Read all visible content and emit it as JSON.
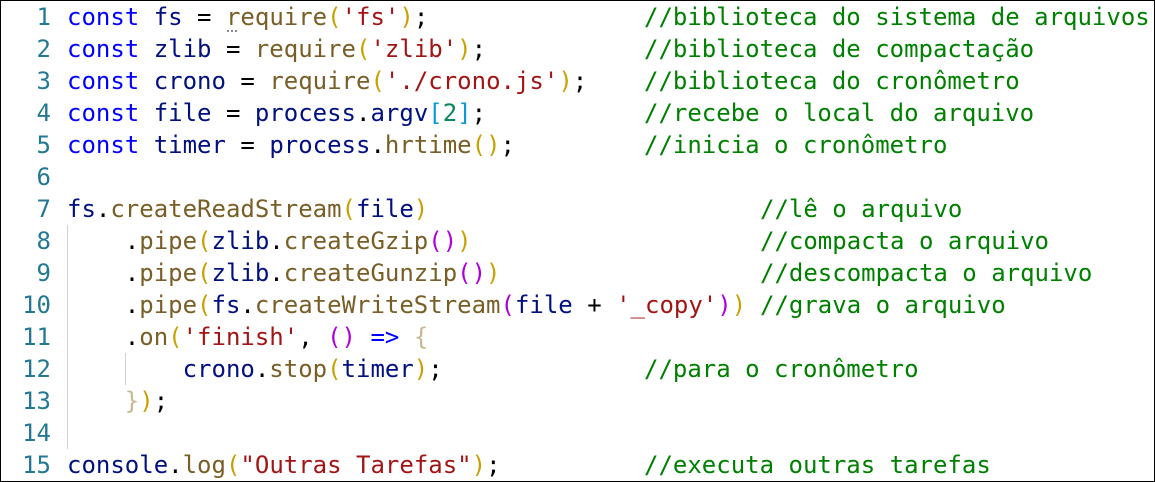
{
  "editor": {
    "colors": {
      "keyword": "#0000ff",
      "variable": "#001080",
      "function": "#795e26",
      "string": "#a31515",
      "number": "#098658",
      "comment": "#008000",
      "line_number": "#237893",
      "bracket_1": "#c8a000",
      "bracket_2": "#af00db",
      "bracket_3": "#0a9ad8"
    },
    "lines": [
      {
        "number": "1",
        "tokens": [
          {
            "t": "const",
            "c": "kw"
          },
          {
            "t": " ",
            "c": "op"
          },
          {
            "t": "fs",
            "c": "var"
          },
          {
            "t": " = ",
            "c": "op"
          },
          {
            "t": "require",
            "c": "fn"
          },
          {
            "t": "(",
            "c": "p1"
          },
          {
            "t": "'fs'",
            "c": "str"
          },
          {
            "t": ")",
            "c": "p1"
          },
          {
            "t": ";",
            "c": "op"
          }
        ],
        "comment": "//biblioteca do sistema de arquivos"
      },
      {
        "number": "2",
        "tokens": [
          {
            "t": "const",
            "c": "kw"
          },
          {
            "t": " ",
            "c": "op"
          },
          {
            "t": "zlib",
            "c": "var"
          },
          {
            "t": " = ",
            "c": "op"
          },
          {
            "t": "require",
            "c": "fn"
          },
          {
            "t": "(",
            "c": "p1"
          },
          {
            "t": "'zlib'",
            "c": "str"
          },
          {
            "t": ")",
            "c": "p1"
          },
          {
            "t": ";",
            "c": "op"
          }
        ],
        "comment": "//biblioteca de compactação"
      },
      {
        "number": "3",
        "tokens": [
          {
            "t": "const",
            "c": "kw"
          },
          {
            "t": " ",
            "c": "op"
          },
          {
            "t": "crono",
            "c": "var"
          },
          {
            "t": " = ",
            "c": "op"
          },
          {
            "t": "require",
            "c": "fn"
          },
          {
            "t": "(",
            "c": "p1"
          },
          {
            "t": "'./crono.js'",
            "c": "str"
          },
          {
            "t": ")",
            "c": "p1"
          },
          {
            "t": ";",
            "c": "op"
          }
        ],
        "comment": "//biblioteca do cronômetro"
      },
      {
        "number": "4",
        "tokens": [
          {
            "t": "const",
            "c": "kw"
          },
          {
            "t": " ",
            "c": "op"
          },
          {
            "t": "file",
            "c": "var"
          },
          {
            "t": " = ",
            "c": "op"
          },
          {
            "t": "process",
            "c": "var"
          },
          {
            "t": ".",
            "c": "op"
          },
          {
            "t": "argv",
            "c": "var"
          },
          {
            "t": "[",
            "c": "p3"
          },
          {
            "t": "2",
            "c": "num"
          },
          {
            "t": "]",
            "c": "p3"
          },
          {
            "t": ";",
            "c": "op"
          }
        ],
        "comment": "//recebe o local do arquivo"
      },
      {
        "number": "5",
        "tokens": [
          {
            "t": "const",
            "c": "kw"
          },
          {
            "t": " ",
            "c": "op"
          },
          {
            "t": "timer",
            "c": "var"
          },
          {
            "t": " = ",
            "c": "op"
          },
          {
            "t": "process",
            "c": "var"
          },
          {
            "t": ".",
            "c": "op"
          },
          {
            "t": "hrtime",
            "c": "fn"
          },
          {
            "t": "()",
            "c": "p1"
          },
          {
            "t": ";",
            "c": "op"
          }
        ],
        "comment": "//inicia o cronômetro"
      },
      {
        "number": "6",
        "tokens": [],
        "comment": ""
      },
      {
        "number": "7",
        "tokens": [
          {
            "t": "fs",
            "c": "var"
          },
          {
            "t": ".",
            "c": "op"
          },
          {
            "t": "createReadStream",
            "c": "fn"
          },
          {
            "t": "(",
            "c": "p1"
          },
          {
            "t": "file",
            "c": "var"
          },
          {
            "t": ")",
            "c": "p1"
          }
        ],
        "comment": "//lê o arquivo"
      },
      {
        "number": "8",
        "tokens": [
          {
            "t": "    .",
            "c": "op"
          },
          {
            "t": "pipe",
            "c": "fn"
          },
          {
            "t": "(",
            "c": "p1"
          },
          {
            "t": "zlib",
            "c": "var"
          },
          {
            "t": ".",
            "c": "op"
          },
          {
            "t": "createGzip",
            "c": "fn"
          },
          {
            "t": "()",
            "c": "p2"
          },
          {
            "t": ")",
            "c": "p1"
          }
        ],
        "comment": "//compacta o arquivo"
      },
      {
        "number": "9",
        "tokens": [
          {
            "t": "    .",
            "c": "op"
          },
          {
            "t": "pipe",
            "c": "fn"
          },
          {
            "t": "(",
            "c": "p1"
          },
          {
            "t": "zlib",
            "c": "var"
          },
          {
            "t": ".",
            "c": "op"
          },
          {
            "t": "createGunzip",
            "c": "fn"
          },
          {
            "t": "()",
            "c": "p2"
          },
          {
            "t": ")",
            "c": "p1"
          }
        ],
        "comment": "//descompacta o arquivo"
      },
      {
        "number": "10",
        "tokens": [
          {
            "t": "    .",
            "c": "op"
          },
          {
            "t": "pipe",
            "c": "fn"
          },
          {
            "t": "(",
            "c": "p1"
          },
          {
            "t": "fs",
            "c": "var"
          },
          {
            "t": ".",
            "c": "op"
          },
          {
            "t": "createWriteStream",
            "c": "fn"
          },
          {
            "t": "(",
            "c": "p2"
          },
          {
            "t": "file",
            "c": "var"
          },
          {
            "t": " + ",
            "c": "op"
          },
          {
            "t": "'_copy'",
            "c": "str"
          },
          {
            "t": ")",
            "c": "p2"
          },
          {
            "t": ")",
            "c": "p1"
          },
          {
            "t": " ",
            "c": "op"
          }
        ],
        "comment": "//grava o arquivo"
      },
      {
        "number": "11",
        "tokens": [
          {
            "t": "    .",
            "c": "op"
          },
          {
            "t": "on",
            "c": "fn"
          },
          {
            "t": "(",
            "c": "p1"
          },
          {
            "t": "'finish'",
            "c": "str"
          },
          {
            "t": ", ",
            "c": "op"
          },
          {
            "t": "()",
            "c": "p2"
          },
          {
            "t": " ",
            "c": "op"
          },
          {
            "t": "=>",
            "c": "kw"
          },
          {
            "t": " ",
            "c": "op"
          },
          {
            "t": "{",
            "c": "dim"
          }
        ],
        "comment": ""
      },
      {
        "number": "12",
        "tokens": [
          {
            "t": "        ",
            "c": "op"
          },
          {
            "t": "crono",
            "c": "var"
          },
          {
            "t": ".",
            "c": "op"
          },
          {
            "t": "stop",
            "c": "fn"
          },
          {
            "t": "(",
            "c": "p1"
          },
          {
            "t": "timer",
            "c": "var"
          },
          {
            "t": ")",
            "c": "p1"
          },
          {
            "t": ";",
            "c": "op"
          }
        ],
        "comment": "//para o cronômetro"
      },
      {
        "number": "13",
        "tokens": [
          {
            "t": "    ",
            "c": "op"
          },
          {
            "t": "}",
            "c": "dim"
          },
          {
            "t": ")",
            "c": "p1"
          },
          {
            "t": ";",
            "c": "op"
          }
        ],
        "comment": ""
      },
      {
        "number": "14",
        "tokens": [],
        "comment": ""
      },
      {
        "number": "15",
        "tokens": [
          {
            "t": "console",
            "c": "var"
          },
          {
            "t": ".",
            "c": "op"
          },
          {
            "t": "log",
            "c": "fn"
          },
          {
            "t": "(",
            "c": "p1"
          },
          {
            "t": "\"Outras Tarefas\"",
            "c": "str"
          },
          {
            "t": ")",
            "c": "p1"
          },
          {
            "t": ";",
            "c": "op"
          }
        ],
        "comment": "//executa outras tarefas"
      }
    ]
  }
}
